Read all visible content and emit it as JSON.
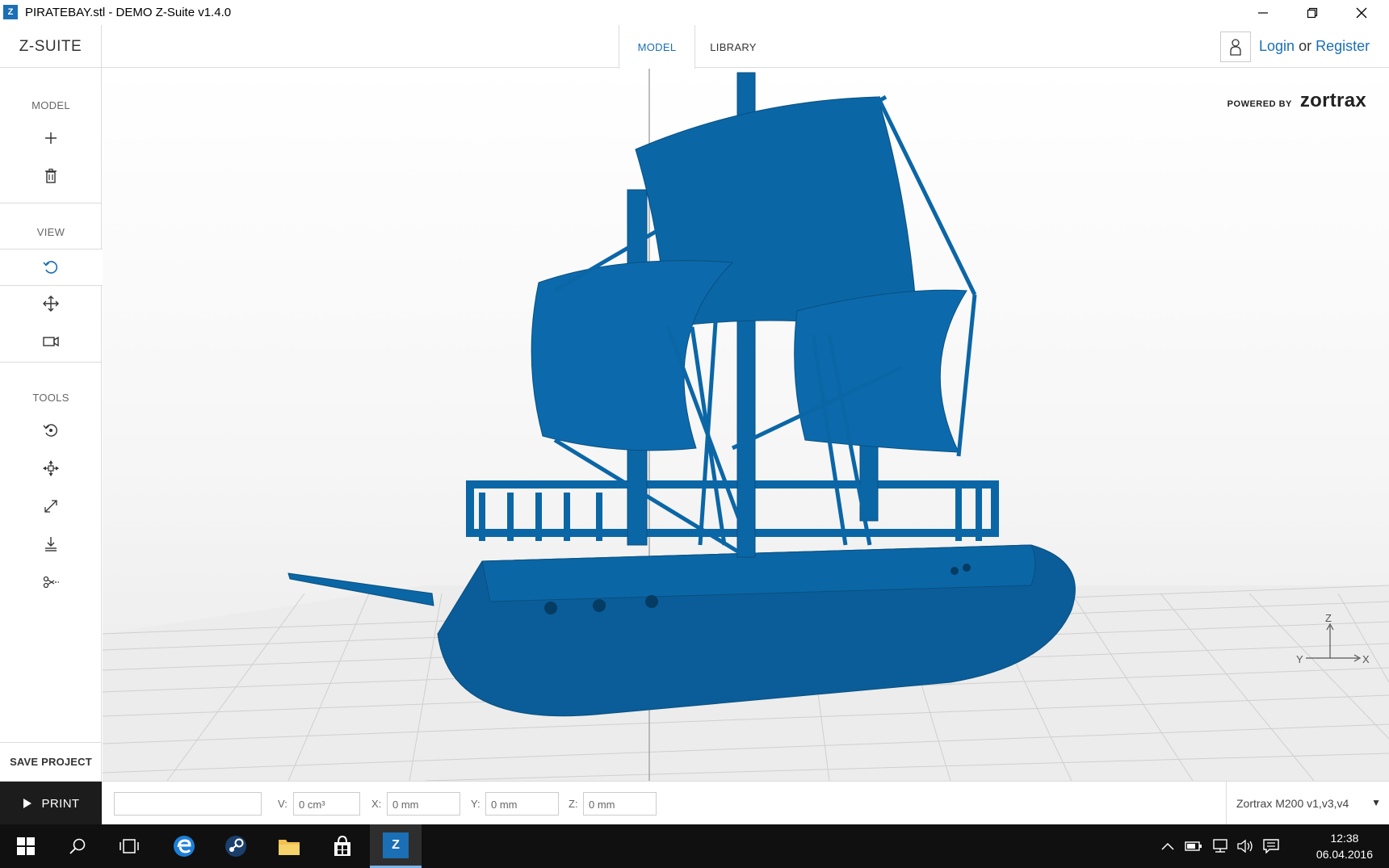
{
  "window": {
    "title": "PIRATEBAY.stl - DEMO Z-Suite v1.4.0",
    "app_icon": "Z"
  },
  "header": {
    "logo": "Z-SUITE",
    "tabs": [
      {
        "label": "MODEL",
        "active": true
      },
      {
        "label": "LIBRARY",
        "active": false
      }
    ],
    "auth": {
      "login": "Login",
      "or": "or",
      "register": "Register"
    }
  },
  "sidebar": {
    "sections": {
      "model": "MODEL",
      "view": "VIEW",
      "tools": "TOOLS"
    },
    "model_tools": [
      "add-icon",
      "trash-icon"
    ],
    "view_tools": [
      "rotate-view-icon",
      "pan-icon",
      "camera-icon"
    ],
    "tools": [
      "rotate-model-icon",
      "move-model-icon",
      "scale-icon",
      "place-on-bed-icon",
      "cut-icon"
    ],
    "save_project": "SAVE PROJECT"
  },
  "viewport": {
    "powered_by": "POWERED BY",
    "brand": "zortrax",
    "model_color": "#0b66a6",
    "axis": {
      "z": "Z",
      "y": "Y",
      "x": "X"
    }
  },
  "bottombar": {
    "print": "PRINT",
    "name_value": "",
    "v_label": "V:",
    "v_value": "0 cm³",
    "x_label": "X:",
    "x_value": "0 mm",
    "y_label": "Y:",
    "y_value": "0 mm",
    "z_label": "Z:",
    "z_value": "0 mm",
    "printer": "Zortrax M200 v1,v3,v4"
  },
  "taskbar": {
    "time": "12:38",
    "date": "06.04.2016",
    "zsuite_label": "Z"
  },
  "colors": {
    "accent": "#1a6fb5",
    "model": "#0b66a6",
    "print_bg": "#1c1c1c",
    "taskbar": "#101010"
  }
}
